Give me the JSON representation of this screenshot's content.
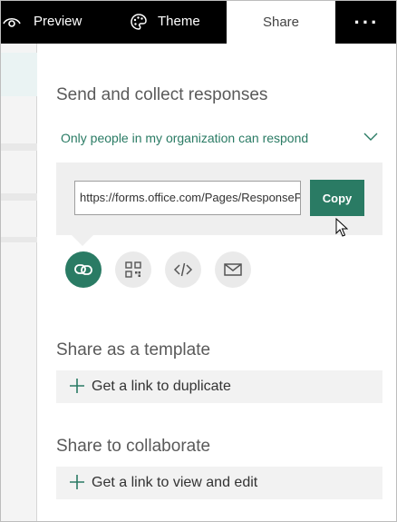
{
  "topbar": {
    "preview_label": "Preview",
    "theme_label": "Theme",
    "share_label": "Share",
    "more_label": "···"
  },
  "send": {
    "heading": "Send and collect responses",
    "permission_selected": "Only people in my organization can respond",
    "link_url": "https://forms.office.com/Pages/ResponsePage.aspx",
    "copy_label": "Copy"
  },
  "share_methods": [
    {
      "icon": "link-icon",
      "active": true
    },
    {
      "icon": "qr-code-icon",
      "active": false
    },
    {
      "icon": "embed-code-icon",
      "active": false
    },
    {
      "icon": "email-icon",
      "active": false
    }
  ],
  "template": {
    "heading": "Share as a template",
    "action_label": "Get a link to duplicate"
  },
  "collaborate": {
    "heading": "Share to collaborate",
    "action_label": "Get a link to view and edit"
  },
  "colors": {
    "accent": "#2a7b64",
    "topbar_bg": "#000000",
    "panel_box_bg": "#efefef"
  }
}
